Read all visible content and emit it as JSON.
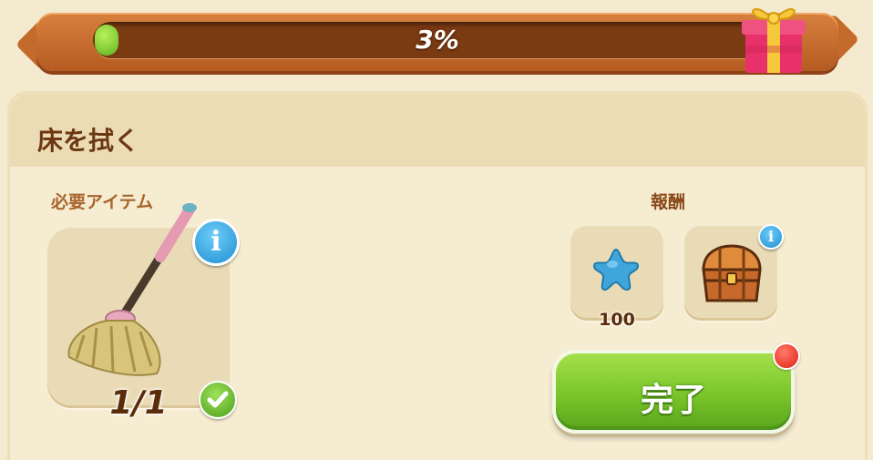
{
  "progress": {
    "text": "3%",
    "value": 0.03,
    "fill_color": "#7bcf2c"
  },
  "gift": {
    "icon": "gift-box-icon"
  },
  "task": {
    "title": "床を拭く"
  },
  "required": {
    "label": "必要アイテム",
    "item_icon": "mop-icon",
    "count": "1/1",
    "info_icon": "info-icon",
    "check_icon": "checkmark-icon"
  },
  "reward": {
    "label": "報酬",
    "items": [
      {
        "icon": "blue-star-icon",
        "amount": "100"
      },
      {
        "icon": "treasure-chest-icon",
        "info_icon": "info-icon"
      }
    ]
  },
  "complete_button": {
    "label": "完了",
    "accent": "#79c52a",
    "badge_color": "#e21f10"
  }
}
